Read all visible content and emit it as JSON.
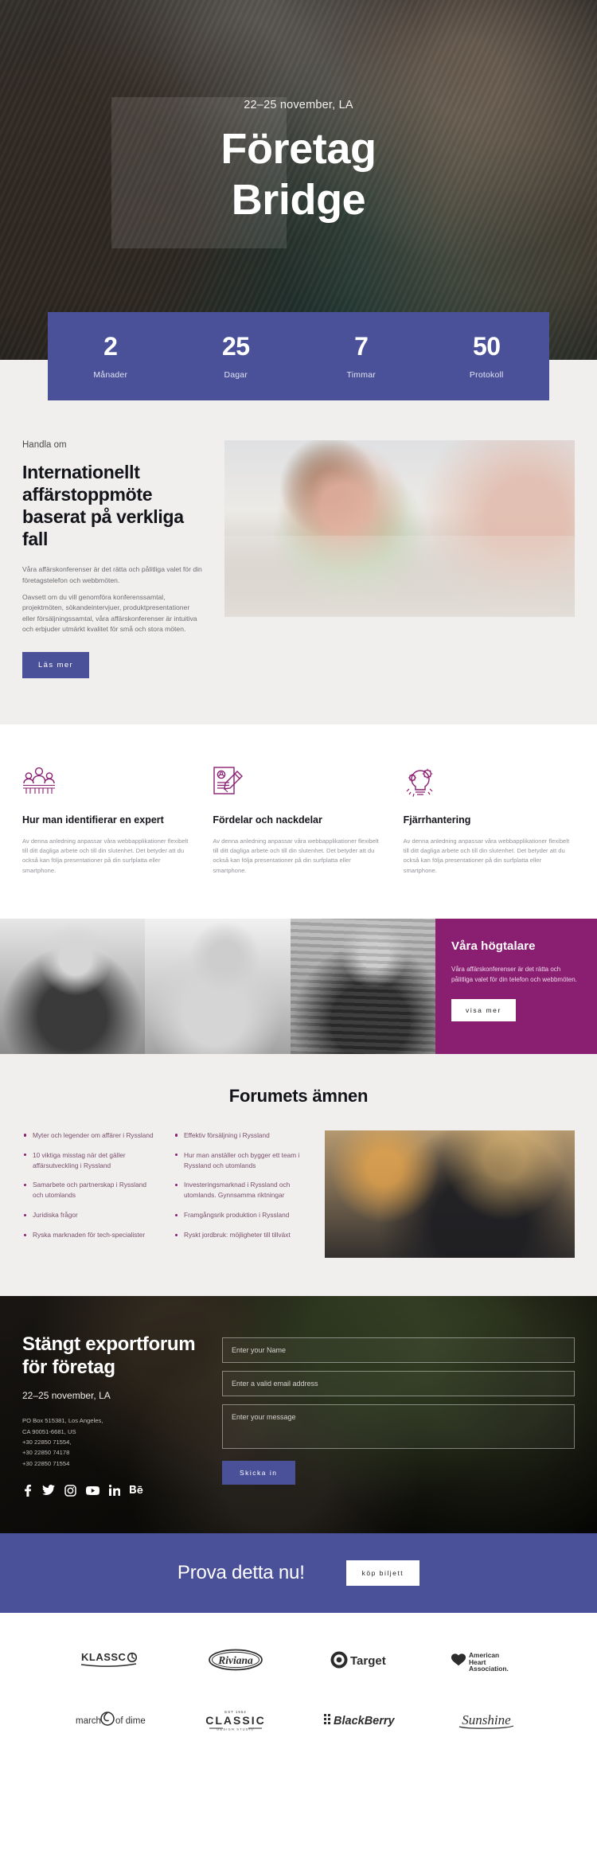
{
  "hero": {
    "date": "22–25 november, LA",
    "title_line1": "Företag",
    "title_line2": "Bridge"
  },
  "counters": [
    {
      "value": "2",
      "label": "Månader"
    },
    {
      "value": "25",
      "label": "Dagar"
    },
    {
      "value": "7",
      "label": "Timmar"
    },
    {
      "value": "50",
      "label": "Protokoll"
    }
  ],
  "about": {
    "eyebrow": "Handla om",
    "heading": "Internationellt affärstoppmöte baserat på verkliga fall",
    "paragraph1": "Våra affärskonferenser är det rätta och pålitliga valet för din företagstelefon och webbmöten.",
    "paragraph2": "Oavsett om du vill genomföra konferenssamtal, projektmöten, sökandeintervjuer, produktpresentationer eller försäljningssamtal, våra affärskonferenser är intuitiva och erbjuder utmärkt kvalitet för små och stora möten.",
    "button": "Läs mer"
  },
  "features": [
    {
      "icon": "team-icon",
      "title": "Hur man identifierar en expert",
      "text": "Av denna anledning anpassar våra webbapplikationer flexibelt till ditt dagliga arbete och till din slutenhet. Det betyder att du också kan följa presentationer på din surfplatta eller smartphone."
    },
    {
      "icon": "document-pencil-icon",
      "title": "Fördelar och nackdelar",
      "text": "Av denna anledning anpassar våra webbapplikationer flexibelt till ditt dagliga arbete och till din slutenhet. Det betyder att du också kan följa presentationer på din surfplatta eller smartphone."
    },
    {
      "icon": "idea-gears-icon",
      "title": "Fjärrhantering",
      "text": "Av denna anledning anpassar våra webbapplikationer flexibelt till ditt dagliga arbete och till din slutenhet. Det betyder att du också kan följa presentationer på din surfplatta eller smartphone."
    }
  ],
  "speakers": {
    "title": "Våra högtalare",
    "text": "Våra affärskonferenser är det rätta och pålitliga valet för din telefon och webbmöten.",
    "button": "visa mer"
  },
  "forum": {
    "title": "Forumets ämnen",
    "column1": [
      "Myter och legender om affärer i Ryssland",
      "10 viktiga misstag när det gäller affärsutveckling i Ryssland",
      "Samarbete och partnerskap i Ryssland och utomlands",
      "Juridiska frågor",
      "Ryska marknaden för tech-specialister"
    ],
    "column2": [
      "Effektiv försäljning i Ryssland",
      "Hur man anställer och bygger ett team i Ryssland och utomlands",
      "Investeringsmarknad i Ryssland och utomlands. Gynnsamma riktningar",
      "Framgångsrik produktion i Ryssland",
      "Ryskt jordbruk: möjligheter till tillväxt"
    ]
  },
  "contact": {
    "heading": "Stängt exportforum för företag",
    "date": "22–25 november, LA",
    "address_line1": "PO Box 515381, Los Angeles,",
    "address_line2": "CA 90051-6681, US",
    "address_line3": "+30 22850 71554,",
    "address_line4": "+30 22850 74178",
    "address_line5": "+30 22850 71554",
    "socials": [
      "facebook-icon",
      "twitter-icon",
      "instagram-icon",
      "youtube-icon",
      "linkedin-icon",
      "behance-icon"
    ],
    "form": {
      "name_placeholder": "Enter your Name",
      "email_placeholder": "Enter a valid email address",
      "message_placeholder": "Enter your message",
      "submit": "Skicka in"
    }
  },
  "cta": {
    "title": "Prova detta nu!",
    "button": "köp biljett"
  },
  "logos": [
    {
      "name": "klassco-logo",
      "text": "KLASSCO"
    },
    {
      "name": "riviana-logo",
      "text": "Riviana"
    },
    {
      "name": "target-logo",
      "text": "Target"
    },
    {
      "name": "american-heart-association-logo",
      "text": "American Heart Association."
    },
    {
      "name": "march-of-dimes-logo",
      "text": "march of dimes"
    },
    {
      "name": "classic-logo",
      "text": "CLASSIC"
    },
    {
      "name": "blackberry-logo",
      "text": "BlackBerry"
    },
    {
      "name": "sunshine-logo",
      "text": "Sunshine"
    }
  ],
  "colors": {
    "indigo": "#4a5199",
    "magenta": "#8a1f72",
    "light_bg": "#f0efee"
  }
}
